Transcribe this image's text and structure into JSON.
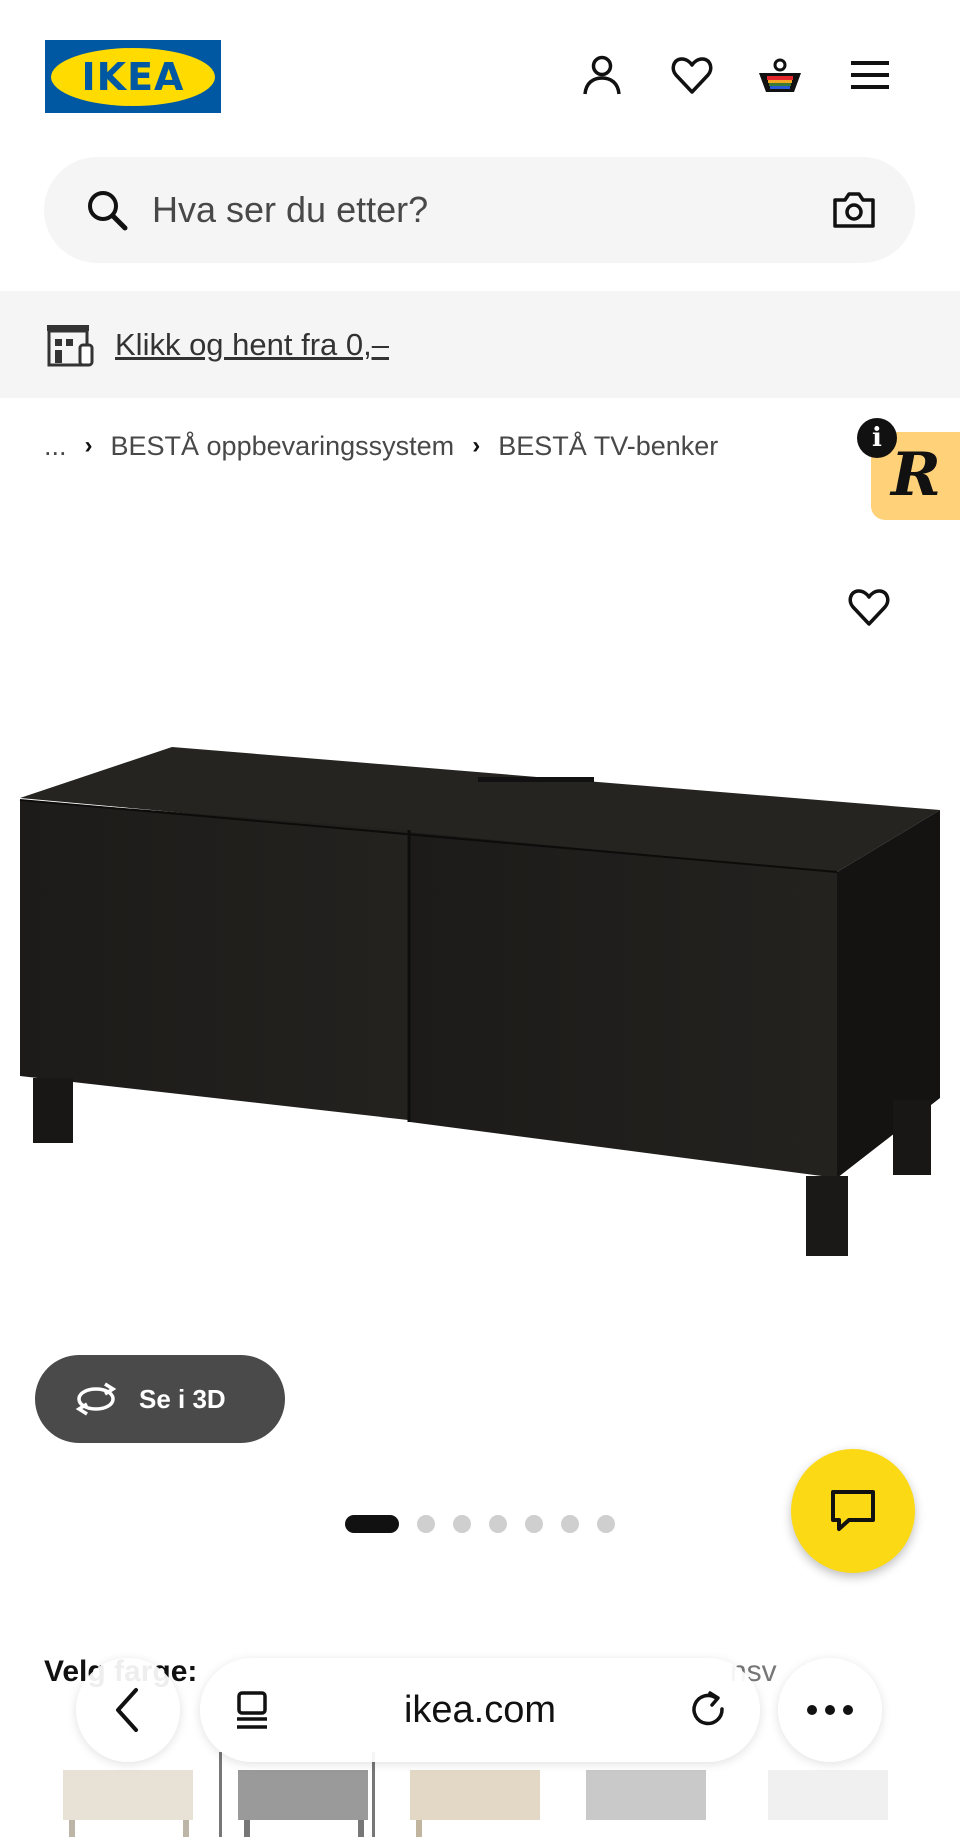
{
  "header": {
    "logo_text": "IKEA",
    "icons": [
      "profile-icon",
      "heart-icon",
      "cart-icon",
      "menu-icon"
    ]
  },
  "search": {
    "placeholder": "Hva ser du etter?",
    "icon": "search-icon",
    "camera_icon": "camera-icon"
  },
  "promo": {
    "text": "Klikk og hent fra 0,–",
    "icon": "store-pickup-icon"
  },
  "breadcrumb": {
    "ellipsis": "...",
    "items": [
      "BESTÅ oppbevaringssystem",
      "BESTÅ TV-benker"
    ]
  },
  "extension": {
    "info": "i",
    "letter": "R"
  },
  "product": {
    "image_icon": "tv-bench-image",
    "view_3d_label": "Se i 3D",
    "carousel_total": 7,
    "carousel_active": 1
  },
  "variant": {
    "label": "Velg farge:",
    "value": "nsv"
  },
  "browser": {
    "url": "ikea.com"
  },
  "colors": {
    "ikea_blue": "#0058a3",
    "ikea_yellow": "#ffdb00",
    "chat_yellow": "#fbd914",
    "badge_peach": "#ffd27a"
  }
}
